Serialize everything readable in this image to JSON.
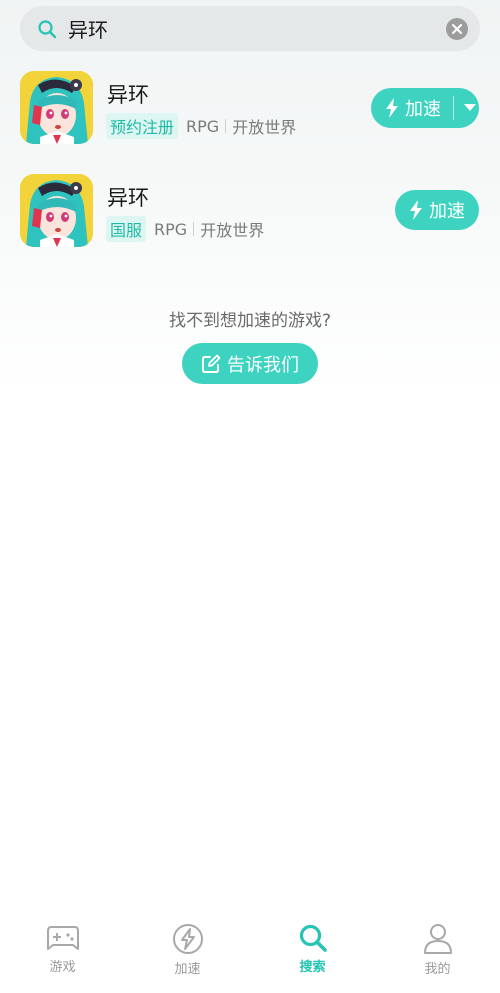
{
  "search": {
    "query": "异环"
  },
  "results": [
    {
      "title": "异环",
      "tag": "预约注册",
      "genre": "RPG",
      "category": "开放世界",
      "action_label": "加速",
      "has_dropdown": true
    },
    {
      "title": "异环",
      "tag": "国服",
      "genre": "RPG",
      "category": "开放世界",
      "action_label": "加速",
      "has_dropdown": false
    }
  ],
  "not_found": {
    "text": "找不到想加速的游戏?",
    "button_label": "告诉我们"
  },
  "bottom_nav": {
    "items": [
      {
        "label": "游戏",
        "icon": "gamepad-icon"
      },
      {
        "label": "加速",
        "icon": "lightning-icon"
      },
      {
        "label": "搜索",
        "icon": "search-icon"
      },
      {
        "label": "我的",
        "icon": "profile-icon"
      }
    ],
    "active": "搜索"
  },
  "colors": {
    "accent": "#3dd3c0",
    "accent_dark": "#26c4b2",
    "tag_bg": "#def6f2",
    "search_bg": "#e5e8e8"
  }
}
